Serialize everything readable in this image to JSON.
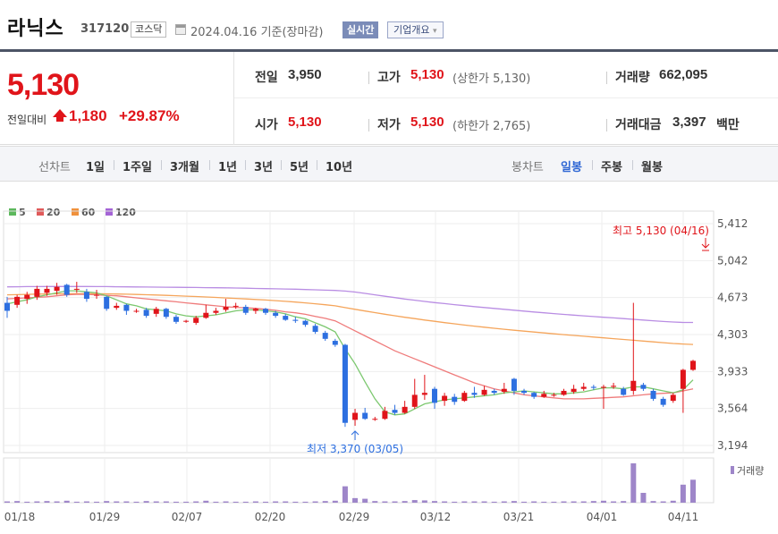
{
  "stock": {
    "name": "라닉스",
    "code": "317120",
    "market": "코스닥",
    "date_text": "2024.04.16 기준(장마감)",
    "realtime_btn": "실시간",
    "company_btn": "기업개요",
    "company_btn_arrow": "▾"
  },
  "price": {
    "current": "5,130",
    "prev_label": "전일대비",
    "change": "1,180",
    "change_pct": "+29.87%",
    "prev_close_label": "전일",
    "prev_close": "3,950",
    "open_label": "시가",
    "open": "5,130",
    "high_label": "고가",
    "high": "5,130",
    "high_limit": "(상한가 5,130)",
    "low_label": "저가",
    "low": "5,130",
    "low_limit": "(하한가 2,765)",
    "volume_label": "거래량",
    "volume": "662,095",
    "amount_label": "거래대금",
    "amount": "3,397",
    "amount_unit": "백만"
  },
  "tabs": {
    "line_label": "선차트",
    "line": [
      "1일",
      "1주일",
      "3개월",
      "1년",
      "3년",
      "5년",
      "10년"
    ],
    "candle_label": "봉차트",
    "candle": [
      "일봉",
      "주봉",
      "월봉"
    ],
    "active_candle": "일봉"
  },
  "legend": [
    {
      "name": "5",
      "color": "#5cb85c"
    },
    {
      "name": "20",
      "color": "#e05a5a"
    },
    {
      "name": "60",
      "color": "#f0913c"
    },
    {
      "name": "120",
      "color": "#a463d6"
    }
  ],
  "chart_data": {
    "type": "candlestick",
    "y_ticks": [
      "5,412",
      "5,042",
      "4,673",
      "4,303",
      "3,933",
      "3,564",
      "3,194"
    ],
    "ylim": [
      3194,
      5412
    ],
    "x_ticks": [
      "01/18",
      "01/29",
      "02/07",
      "02/20",
      "02/29",
      "03/12",
      "03/21",
      "04/01",
      "04/11"
    ],
    "high_annotation": "최고 5,130 (04/16)",
    "low_annotation": "최저 3,370 (03/05)",
    "volume_label": "거래량",
    "candles": [
      [
        4620,
        4540,
        4680,
        4470
      ],
      [
        4600,
        4680,
        4700,
        4570
      ],
      [
        4660,
        4700,
        4730,
        4610
      ],
      [
        4680,
        4760,
        4790,
        4650
      ],
      [
        4720,
        4760,
        4790,
        4690
      ],
      [
        4740,
        4780,
        4820,
        4700
      ],
      [
        4800,
        4700,
        4810,
        4680
      ],
      [
        4760,
        4760,
        4830,
        4720
      ],
      [
        4730,
        4660,
        4760,
        4630
      ],
      [
        4700,
        4700,
        4750,
        4660
      ],
      [
        4680,
        4560,
        4690,
        4540
      ],
      [
        4570,
        4590,
        4620,
        4550
      ],
      [
        4600,
        4540,
        4610,
        4500
      ],
      [
        4540,
        4540,
        4560,
        4520
      ],
      [
        4550,
        4490,
        4570,
        4470
      ],
      [
        4510,
        4560,
        4580,
        4480
      ],
      [
        4560,
        4480,
        4570,
        4460
      ],
      [
        4480,
        4430,
        4500,
        4410
      ],
      [
        4440,
        4440,
        4450,
        4420
      ],
      [
        4420,
        4470,
        4490,
        4400
      ],
      [
        4470,
        4520,
        4600,
        4460
      ],
      [
        4520,
        4540,
        4570,
        4500
      ],
      [
        4550,
        4580,
        4660,
        4530
      ],
      [
        4590,
        4590,
        4620,
        4560
      ],
      [
        4580,
        4520,
        4600,
        4500
      ],
      [
        4540,
        4560,
        4570,
        4510
      ],
      [
        4560,
        4520,
        4570,
        4500
      ],
      [
        4520,
        4490,
        4540,
        4470
      ],
      [
        4490,
        4450,
        4510,
        4440
      ],
      [
        4450,
        4440,
        4480,
        4420
      ],
      [
        4440,
        4400,
        4450,
        4380
      ],
      [
        4390,
        4330,
        4410,
        4310
      ],
      [
        4320,
        4260,
        4340,
        4240
      ],
      [
        4240,
        4200,
        4260,
        4180
      ],
      [
        4200,
        3420,
        4210,
        3380
      ],
      [
        3450,
        3520,
        3560,
        3390
      ],
      [
        3520,
        3460,
        3570,
        3450
      ],
      [
        3460,
        3460,
        3480,
        3440
      ],
      [
        3460,
        3540,
        3580,
        3450
      ],
      [
        3550,
        3520,
        3600,
        3500
      ],
      [
        3520,
        3580,
        3640,
        3510
      ],
      [
        3580,
        3700,
        3860,
        3560
      ],
      [
        3700,
        3720,
        3900,
        3650
      ],
      [
        3760,
        3620,
        3780,
        3560
      ],
      [
        3640,
        3690,
        3720,
        3590
      ],
      [
        3680,
        3630,
        3710,
        3600
      ],
      [
        3640,
        3720,
        3740,
        3630
      ],
      [
        3720,
        3700,
        3780,
        3670
      ],
      [
        3700,
        3750,
        3790,
        3690
      ],
      [
        3740,
        3720,
        3760,
        3700
      ],
      [
        3730,
        3760,
        3820,
        3710
      ],
      [
        3860,
        3740,
        3870,
        3700
      ],
      [
        3740,
        3720,
        3760,
        3700
      ],
      [
        3720,
        3680,
        3730,
        3660
      ],
      [
        3680,
        3710,
        3740,
        3670
      ],
      [
        3700,
        3700,
        3720,
        3680
      ],
      [
        3700,
        3740,
        3760,
        3690
      ],
      [
        3730,
        3760,
        3800,
        3710
      ],
      [
        3760,
        3780,
        3820,
        3740
      ],
      [
        3780,
        3770,
        3800,
        3750
      ],
      [
        3770,
        3780,
        3800,
        3560
      ],
      [
        3780,
        3790,
        3820,
        3760
      ],
      [
        3760,
        3700,
        3780,
        3690
      ],
      [
        3740,
        3840,
        4620,
        3700
      ],
      [
        3800,
        3760,
        3820,
        3740
      ],
      [
        3740,
        3660,
        3760,
        3640
      ],
      [
        3660,
        3600,
        3680,
        3580
      ],
      [
        3640,
        3700,
        3720,
        3620
      ],
      [
        3760,
        3950,
        3960,
        3520
      ],
      [
        3950,
        4040,
        4050,
        3940
      ]
    ],
    "volumes": [
      4,
      5,
      3,
      4,
      5,
      4,
      6,
      3,
      4,
      3,
      5,
      4,
      4,
      3,
      5,
      4,
      4,
      3,
      3,
      4,
      6,
      3,
      4,
      3,
      3,
      4,
      3,
      4,
      4,
      3,
      3,
      4,
      5,
      6,
      50,
      14,
      12,
      5,
      4,
      4,
      5,
      8,
      7,
      5,
      4,
      3,
      4,
      4,
      4,
      3,
      4,
      5,
      3,
      4,
      3,
      3,
      4,
      4,
      4,
      5,
      6,
      4,
      5,
      120,
      30,
      5,
      4,
      6,
      55,
      70
    ],
    "ma5": [
      4610,
      4630,
      4650,
      4680,
      4700,
      4720,
      4740,
      4740,
      4730,
      4720,
      4690,
      4650,
      4610,
      4590,
      4560,
      4550,
      4540,
      4510,
      4490,
      4480,
      4490,
      4500,
      4520,
      4540,
      4550,
      4550,
      4540,
      4530,
      4510,
      4480,
      4460,
      4420,
      4380,
      4330,
      4160,
      4010,
      3830,
      3660,
      3530,
      3500,
      3510,
      3560,
      3610,
      3630,
      3650,
      3660,
      3670,
      3680,
      3690,
      3700,
      3720,
      3730,
      3740,
      3730,
      3720,
      3710,
      3710,
      3720,
      3730,
      3750,
      3770,
      3770,
      3760,
      3780,
      3780,
      3760,
      3740,
      3720,
      3750,
      3850
    ],
    "ma20": [
      4660,
      4665,
      4670,
      4675,
      4680,
      4690,
      4700,
      4705,
      4705,
      4700,
      4695,
      4690,
      4680,
      4670,
      4660,
      4650,
      4640,
      4630,
      4620,
      4610,
      4600,
      4590,
      4580,
      4575,
      4570,
      4565,
      4555,
      4545,
      4530,
      4520,
      4505,
      4485,
      4465,
      4440,
      4390,
      4340,
      4290,
      4240,
      4190,
      4140,
      4100,
      4060,
      4020,
      3980,
      3940,
      3900,
      3860,
      3820,
      3790,
      3760,
      3740,
      3720,
      3700,
      3690,
      3680,
      3670,
      3660,
      3660,
      3660,
      3665,
      3670,
      3675,
      3680,
      3690,
      3700,
      3710,
      3715,
      3720,
      3740,
      3760
    ],
    "ma60": [
      4700,
      4702,
      4705,
      4707,
      4709,
      4710,
      4711,
      4712,
      4712,
      4711,
      4710,
      4708,
      4706,
      4704,
      4701,
      4698,
      4695,
      4691,
      4687,
      4683,
      4679,
      4674,
      4669,
      4664,
      4659,
      4654,
      4648,
      4642,
      4635,
      4628,
      4620,
      4611,
      4601,
      4590,
      4572,
      4555,
      4538,
      4522,
      4506,
      4491,
      4476,
      4462,
      4448,
      4435,
      4422,
      4410,
      4398,
      4387,
      4376,
      4366,
      4356,
      4346,
      4337,
      4328,
      4319,
      4310,
      4302,
      4294,
      4286,
      4278,
      4270,
      4262,
      4254,
      4246,
      4238,
      4230,
      4222,
      4214,
      4208,
      4204
    ],
    "ma120": [
      4780,
      4781,
      4782,
      4782,
      4783,
      4783,
      4783,
      4783,
      4783,
      4782,
      4782,
      4781,
      4780,
      4779,
      4778,
      4777,
      4776,
      4775,
      4774,
      4773,
      4772,
      4771,
      4770,
      4768,
      4766,
      4764,
      4762,
      4760,
      4758,
      4756,
      4753,
      4750,
      4747,
      4744,
      4738,
      4728,
      4714,
      4700,
      4686,
      4672,
      4658,
      4646,
      4634,
      4622,
      4612,
      4602,
      4592,
      4582,
      4573,
      4564,
      4555,
      4546,
      4537,
      4528,
      4520,
      4512,
      4504,
      4497,
      4490,
      4483,
      4476,
      4469,
      4462,
      4455,
      4448,
      4441,
      4434,
      4428,
      4424,
      4424
    ]
  }
}
